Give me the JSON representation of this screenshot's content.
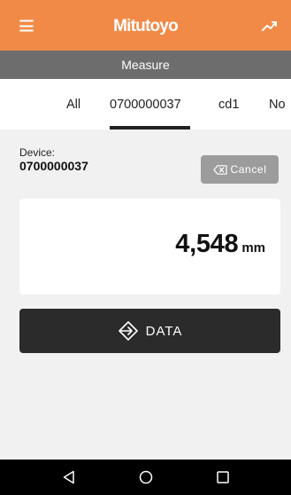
{
  "app": {
    "brand": "Mitutoyo",
    "subtitle": "Measure",
    "accent_color": "#f28a47",
    "icons": {
      "menu": "hamburger-menu-icon",
      "trend": "trend-chart-icon"
    }
  },
  "tabs": [
    {
      "label": "All",
      "selected": false
    },
    {
      "label": "0700000037",
      "selected": true
    },
    {
      "label": "cd1",
      "selected": false
    },
    {
      "label": "No",
      "selected": false
    }
  ],
  "device": {
    "caption": "Device:",
    "id": "0700000037",
    "cancel_label": "Cancel",
    "cancel_icon": "backspace-icon"
  },
  "measurement": {
    "value": "4,548",
    "unit": "mm"
  },
  "data_button": {
    "label": "DATA",
    "icon": "arrow-into-icon"
  },
  "system_nav": {
    "icons": [
      "back-triangle-icon",
      "home-circle-icon",
      "recents-square-icon"
    ]
  }
}
